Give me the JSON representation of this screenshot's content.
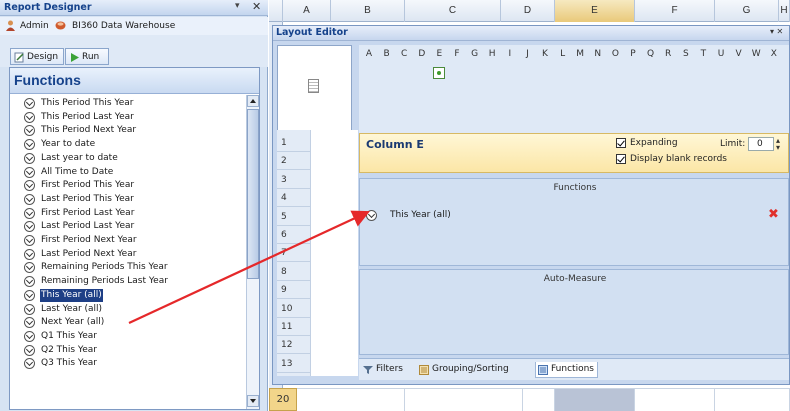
{
  "report_designer": {
    "title": "Report Designer",
    "user": "Admin",
    "warehouse": "BI360 Data Warehouse",
    "tabs": [
      "Design",
      "Run"
    ]
  },
  "functions_panel": {
    "title": "Functions",
    "items": [
      "This Period This Year",
      "This Period Last Year",
      "This Period Next Year",
      "Year to date",
      "Last year to date",
      "All Time to Date",
      "First Period This Year",
      "Last Period This Year",
      "First Period Last Year",
      "Last Period Last Year",
      "First Period Next Year",
      "Last Period Next Year",
      "Remaining Periods This Year",
      "Remaining Periods Last Year",
      "This Year (all)",
      "Last Year (all)",
      "Next Year (all)",
      "Q1 This Year",
      "Q2 This Year",
      "Q3 This Year"
    ],
    "selected_index": 14
  },
  "spreadsheet": {
    "columns": [
      "A",
      "B",
      "C",
      "D",
      "E",
      "F",
      "G",
      "H"
    ],
    "highlighted_column": "E",
    "active_row": "20"
  },
  "layout_editor": {
    "title": "Layout Editor",
    "column_letters": [
      "A",
      "B",
      "C",
      "D",
      "E",
      "F",
      "G",
      "H",
      "I",
      "J",
      "K",
      "L",
      "M",
      "N",
      "O",
      "P",
      "Q",
      "R",
      "S",
      "T",
      "U",
      "V",
      "W",
      "X"
    ],
    "row_numbers": [
      "1",
      "2",
      "3",
      "4",
      "5",
      "6",
      "7",
      "8",
      "9",
      "10",
      "11",
      "12",
      "13"
    ],
    "column_title": "Column E",
    "expanding_label": "Expanding",
    "display_blank_label": "Display blank records",
    "limit_label": "Limit:",
    "limit_value": "0",
    "functions_section": "Functions",
    "applied_function": "This Year (all)",
    "auto_measure_section": "Auto-Measure",
    "bottom_tabs": [
      "Filters",
      "Grouping/Sorting",
      "Functions"
    ]
  }
}
